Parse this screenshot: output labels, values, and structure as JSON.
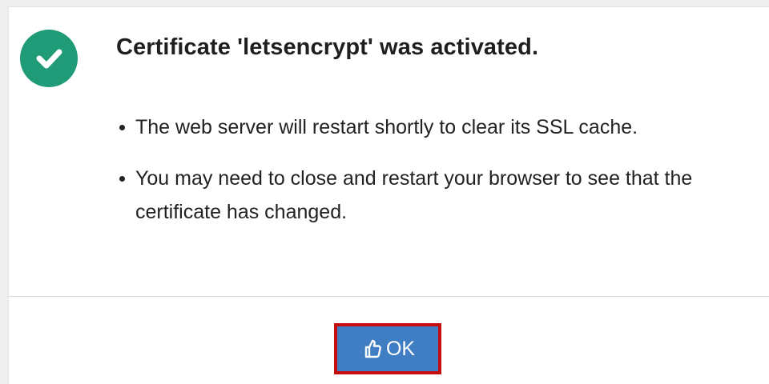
{
  "dialog": {
    "title": "Certificate 'letsencrypt' was activated.",
    "status_icon": "check-circle-icon",
    "messages": [
      "The web server will restart shortly to clear its SSL cache.",
      "You may need to close and restart your browser to see that the certificate has changed."
    ],
    "ok_button": {
      "label": "OK",
      "icon": "thumbs-up-icon"
    }
  },
  "colors": {
    "success": "#1f9b78",
    "button": "#3f7ec3",
    "highlight": "#c70d10"
  }
}
